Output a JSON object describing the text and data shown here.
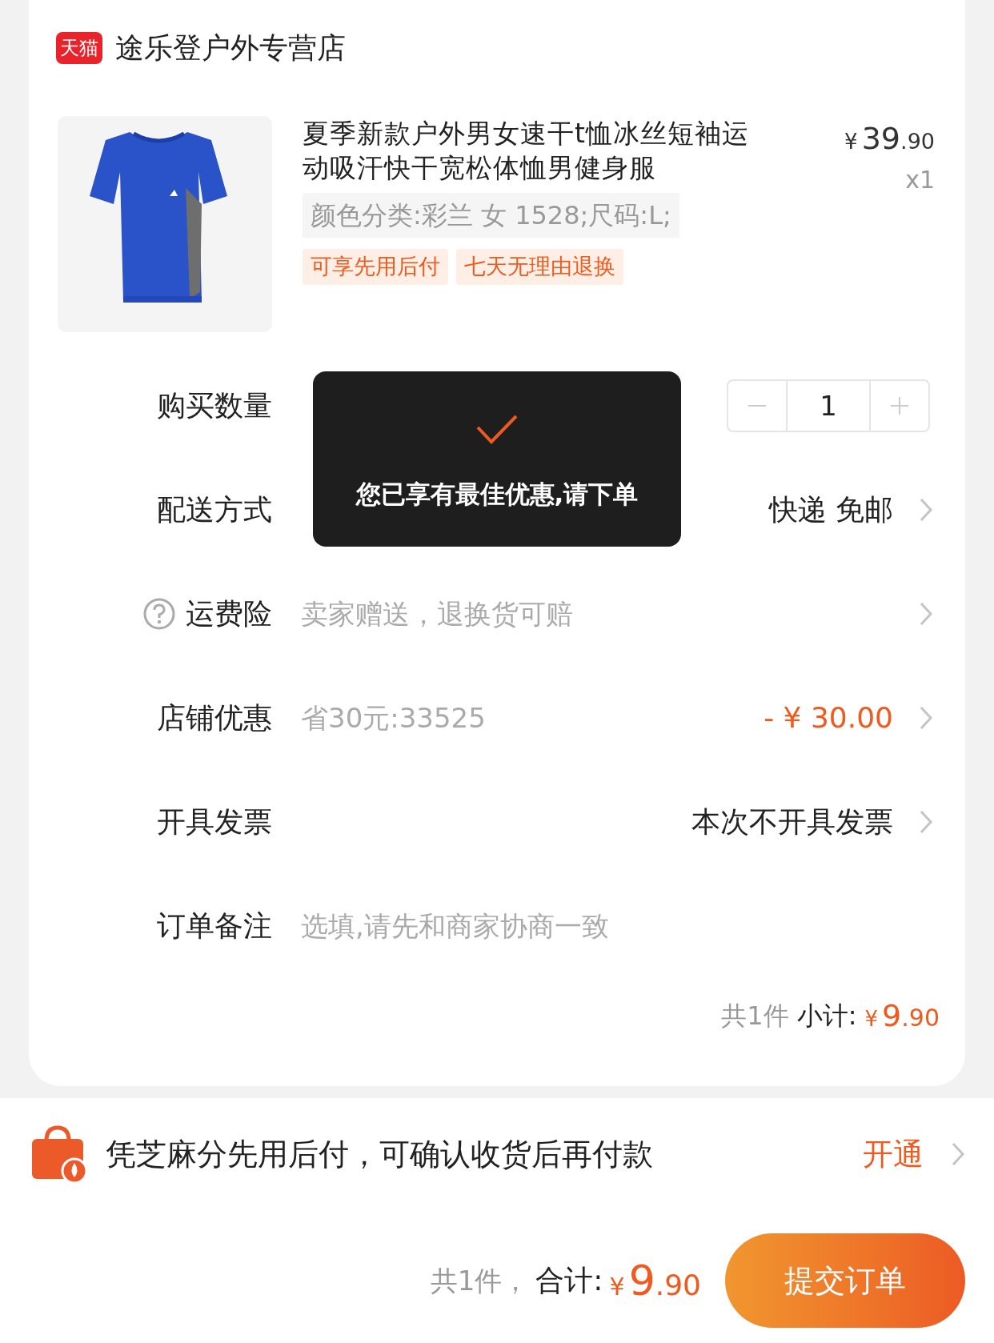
{
  "store": {
    "badge": "天猫",
    "name": "途乐登户外专营店"
  },
  "product": {
    "title": "夏季新款户外男女速干t恤冰丝短袖运动吸汗快干宽松体恤男健身服",
    "price_symbol": "¥",
    "price_int": "39",
    "price_dec": ".90",
    "quantity": "x1",
    "spec": "颜色分类:彩兰 女 1528;尺码:L;",
    "tags": [
      "可享先用后付",
      "七天无理由退换"
    ]
  },
  "rows": [
    {
      "kind": "stepper",
      "label": "购买数量",
      "value": "1"
    },
    {
      "kind": "link",
      "label": "配送方式",
      "value": "快递 免邮"
    },
    {
      "kind": "link",
      "help": true,
      "label": "运费险",
      "hint": "卖家赠送，退换货可赔"
    },
    {
      "kind": "discount",
      "label": "店铺优惠",
      "hint": "省30元:33525",
      "value": "- ¥ 30.00"
    },
    {
      "kind": "link",
      "label": "开具发票",
      "value": "本次不开具发票"
    },
    {
      "kind": "input",
      "label": "订单备注",
      "placeholder": "选填,请先和商家协商一致"
    }
  ],
  "subtotal": {
    "count": "共1件",
    "label": "小计:",
    "symbol": "¥",
    "int": "9",
    "dec": ".90"
  },
  "pay_later": {
    "text": "凭芝麻分先用后付，可确认收货后再付款",
    "action": "开通"
  },
  "footer": {
    "count": "共1件，",
    "label": "合计:",
    "symbol": "¥",
    "int": "9",
    "dec": ".90",
    "button": "提交订单"
  },
  "toast": {
    "message": "您已享有最佳优惠,请下单"
  }
}
